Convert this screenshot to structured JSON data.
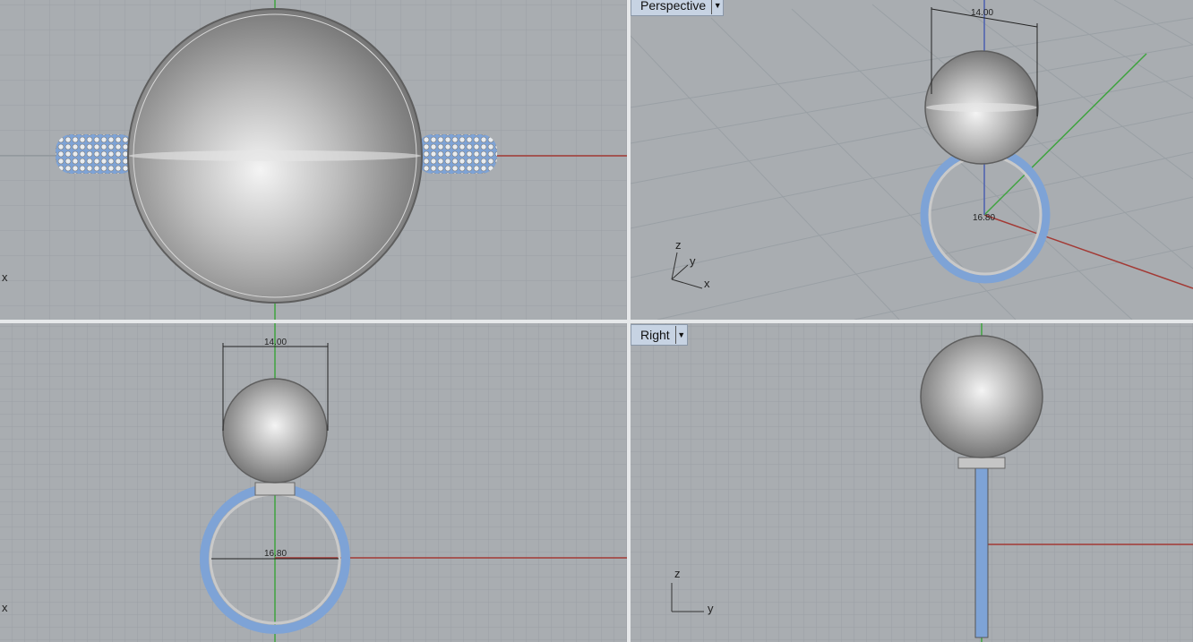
{
  "viewports": {
    "top": {
      "axis_x": "x"
    },
    "perspective": {
      "tab_label": "Perspective",
      "dimension_top": "14.00",
      "dimension_ring": "16.80",
      "triad": {
        "z": "z",
        "y": "y",
        "x": "x"
      }
    },
    "front": {
      "axis_x": "x",
      "dimension_top": "14.00",
      "dimension_ring": "16.80"
    },
    "right": {
      "tab_label": "Right",
      "triad": {
        "z": "z",
        "y": "y"
      }
    }
  },
  "colors": {
    "grid_bg": "#a9adb1",
    "grid_minor": "#9aa0a5",
    "grid_major": "#8c9298",
    "axis_x_red": "#a33a35",
    "axis_y_green": "#3fa33f",
    "axis_z_blue": "#4a5fb0",
    "gem_blue": "#7ea3d6"
  },
  "icons": {
    "dropdown": "chevron-down-icon"
  }
}
